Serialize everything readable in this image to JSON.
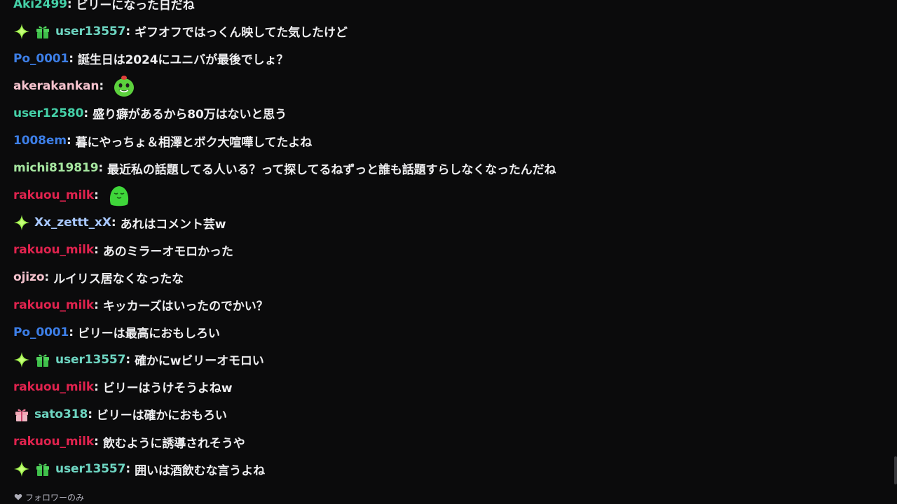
{
  "chat": {
    "messages": [
      {
        "user": "Aki2499",
        "color": "#45d1a8",
        "text": "ビリーになった日だね",
        "badges": []
      },
      {
        "user": "user13557",
        "color": "#6ed6c2",
        "text": "ギフオフではっくん映してた気したけど",
        "badges": [
          "sparkle-badge",
          "gift-badge"
        ]
      },
      {
        "user": "Po_0001",
        "color": "#3d7fe8",
        "text": "誕生日は2024にユニバが最後でしょ？",
        "badges": []
      },
      {
        "user": "akerakankan",
        "color": "#f5c2cd",
        "text": "",
        "badges": [],
        "emote": "green-blob-emote"
      },
      {
        "user": "user12580",
        "color": "#45d1a8",
        "text": "盛り癖があるから80万はないと思う",
        "badges": []
      },
      {
        "user": "1008em",
        "color": "#3d7fe8",
        "text": "暮にやっちょ＆相澤とボク大喧嘩してたよね",
        "badges": []
      },
      {
        "user": "michi819819",
        "color": "#a6e6a0",
        "text": "最近私の話題してる人いる？って探してるねずっと誰も話題すらしなくなったんだね",
        "badges": []
      },
      {
        "user": "rakuou_milk",
        "color": "#e0234e",
        "text": "",
        "badges": [],
        "emote": "sleepy-blob-emote"
      },
      {
        "user": "Xx_zettt_xX",
        "color": "#a8c8ff",
        "text": "あれはコメント芸w",
        "badges": [
          "sparkle-badge"
        ]
      },
      {
        "user": "rakuou_milk",
        "color": "#e0234e",
        "text": "あのミラーオモロかった",
        "badges": []
      },
      {
        "user": "ojizo",
        "color": "#f5c2cd",
        "text": "ルイリス居なくなったな",
        "badges": []
      },
      {
        "user": "rakuou_milk",
        "color": "#e0234e",
        "text": "キッカーズはいったのでかい？",
        "badges": []
      },
      {
        "user": "Po_0001",
        "color": "#3d7fe8",
        "text": "ビリーは最高におもしろい",
        "badges": []
      },
      {
        "user": "user13557",
        "color": "#6ed6c2",
        "text": "確かにwビリーオモロい",
        "badges": [
          "sparkle-badge",
          "gift-badge"
        ]
      },
      {
        "user": "rakuou_milk",
        "color": "#e0234e",
        "text": "ビリーはうけそうよねw",
        "badges": []
      },
      {
        "user": "sato318",
        "color": "#6ed6c2",
        "text": "ビリーは確かにおもろい",
        "badges": [
          "pink-gift-badge"
        ]
      },
      {
        "user": "rakuou_milk",
        "color": "#e0234e",
        "text": "飲むように誘導されそうや",
        "badges": []
      },
      {
        "user": "user13557",
        "color": "#6ed6c2",
        "text": "囲いは酒飲むな言うよね",
        "badges": [
          "sparkle-badge",
          "gift-badge"
        ]
      }
    ]
  },
  "footer": {
    "mode_label": "フォロワーのみ",
    "mode_icon": "heart-icon"
  }
}
